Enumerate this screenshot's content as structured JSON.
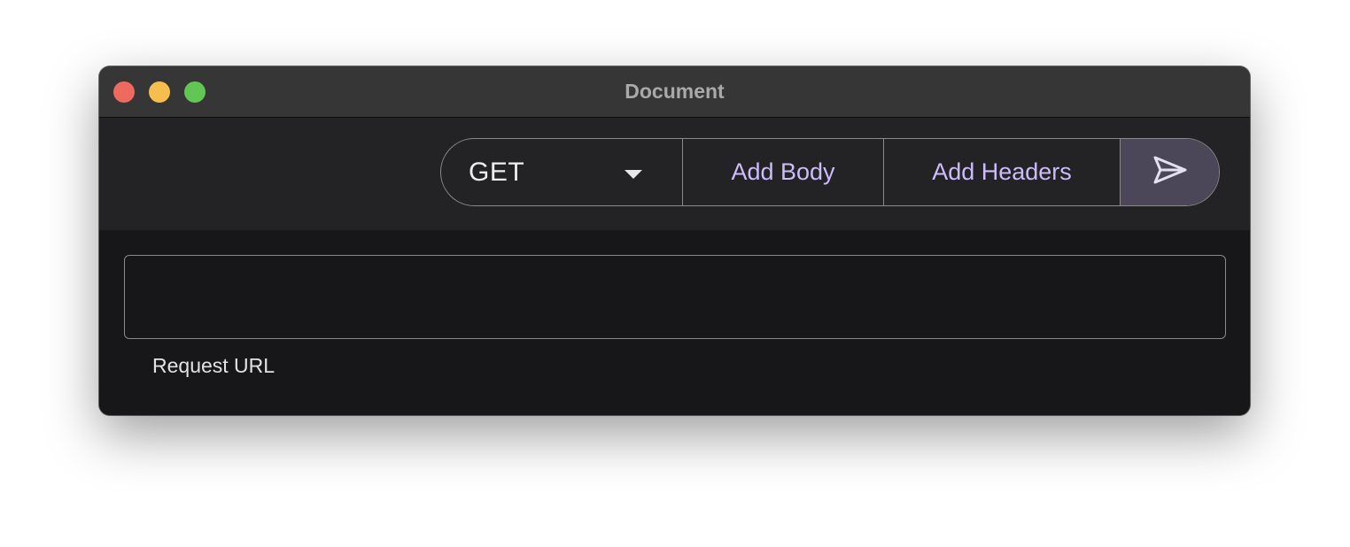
{
  "window": {
    "title": "Document"
  },
  "toolbar": {
    "method": "GET",
    "add_body_label": "Add Body",
    "add_headers_label": "Add Headers",
    "send_icon": "send-icon"
  },
  "request": {
    "url_value": "",
    "url_label": "Request URL"
  },
  "colors": {
    "accent": "#cdbcfa",
    "send_button_bg": "#4b4658"
  }
}
